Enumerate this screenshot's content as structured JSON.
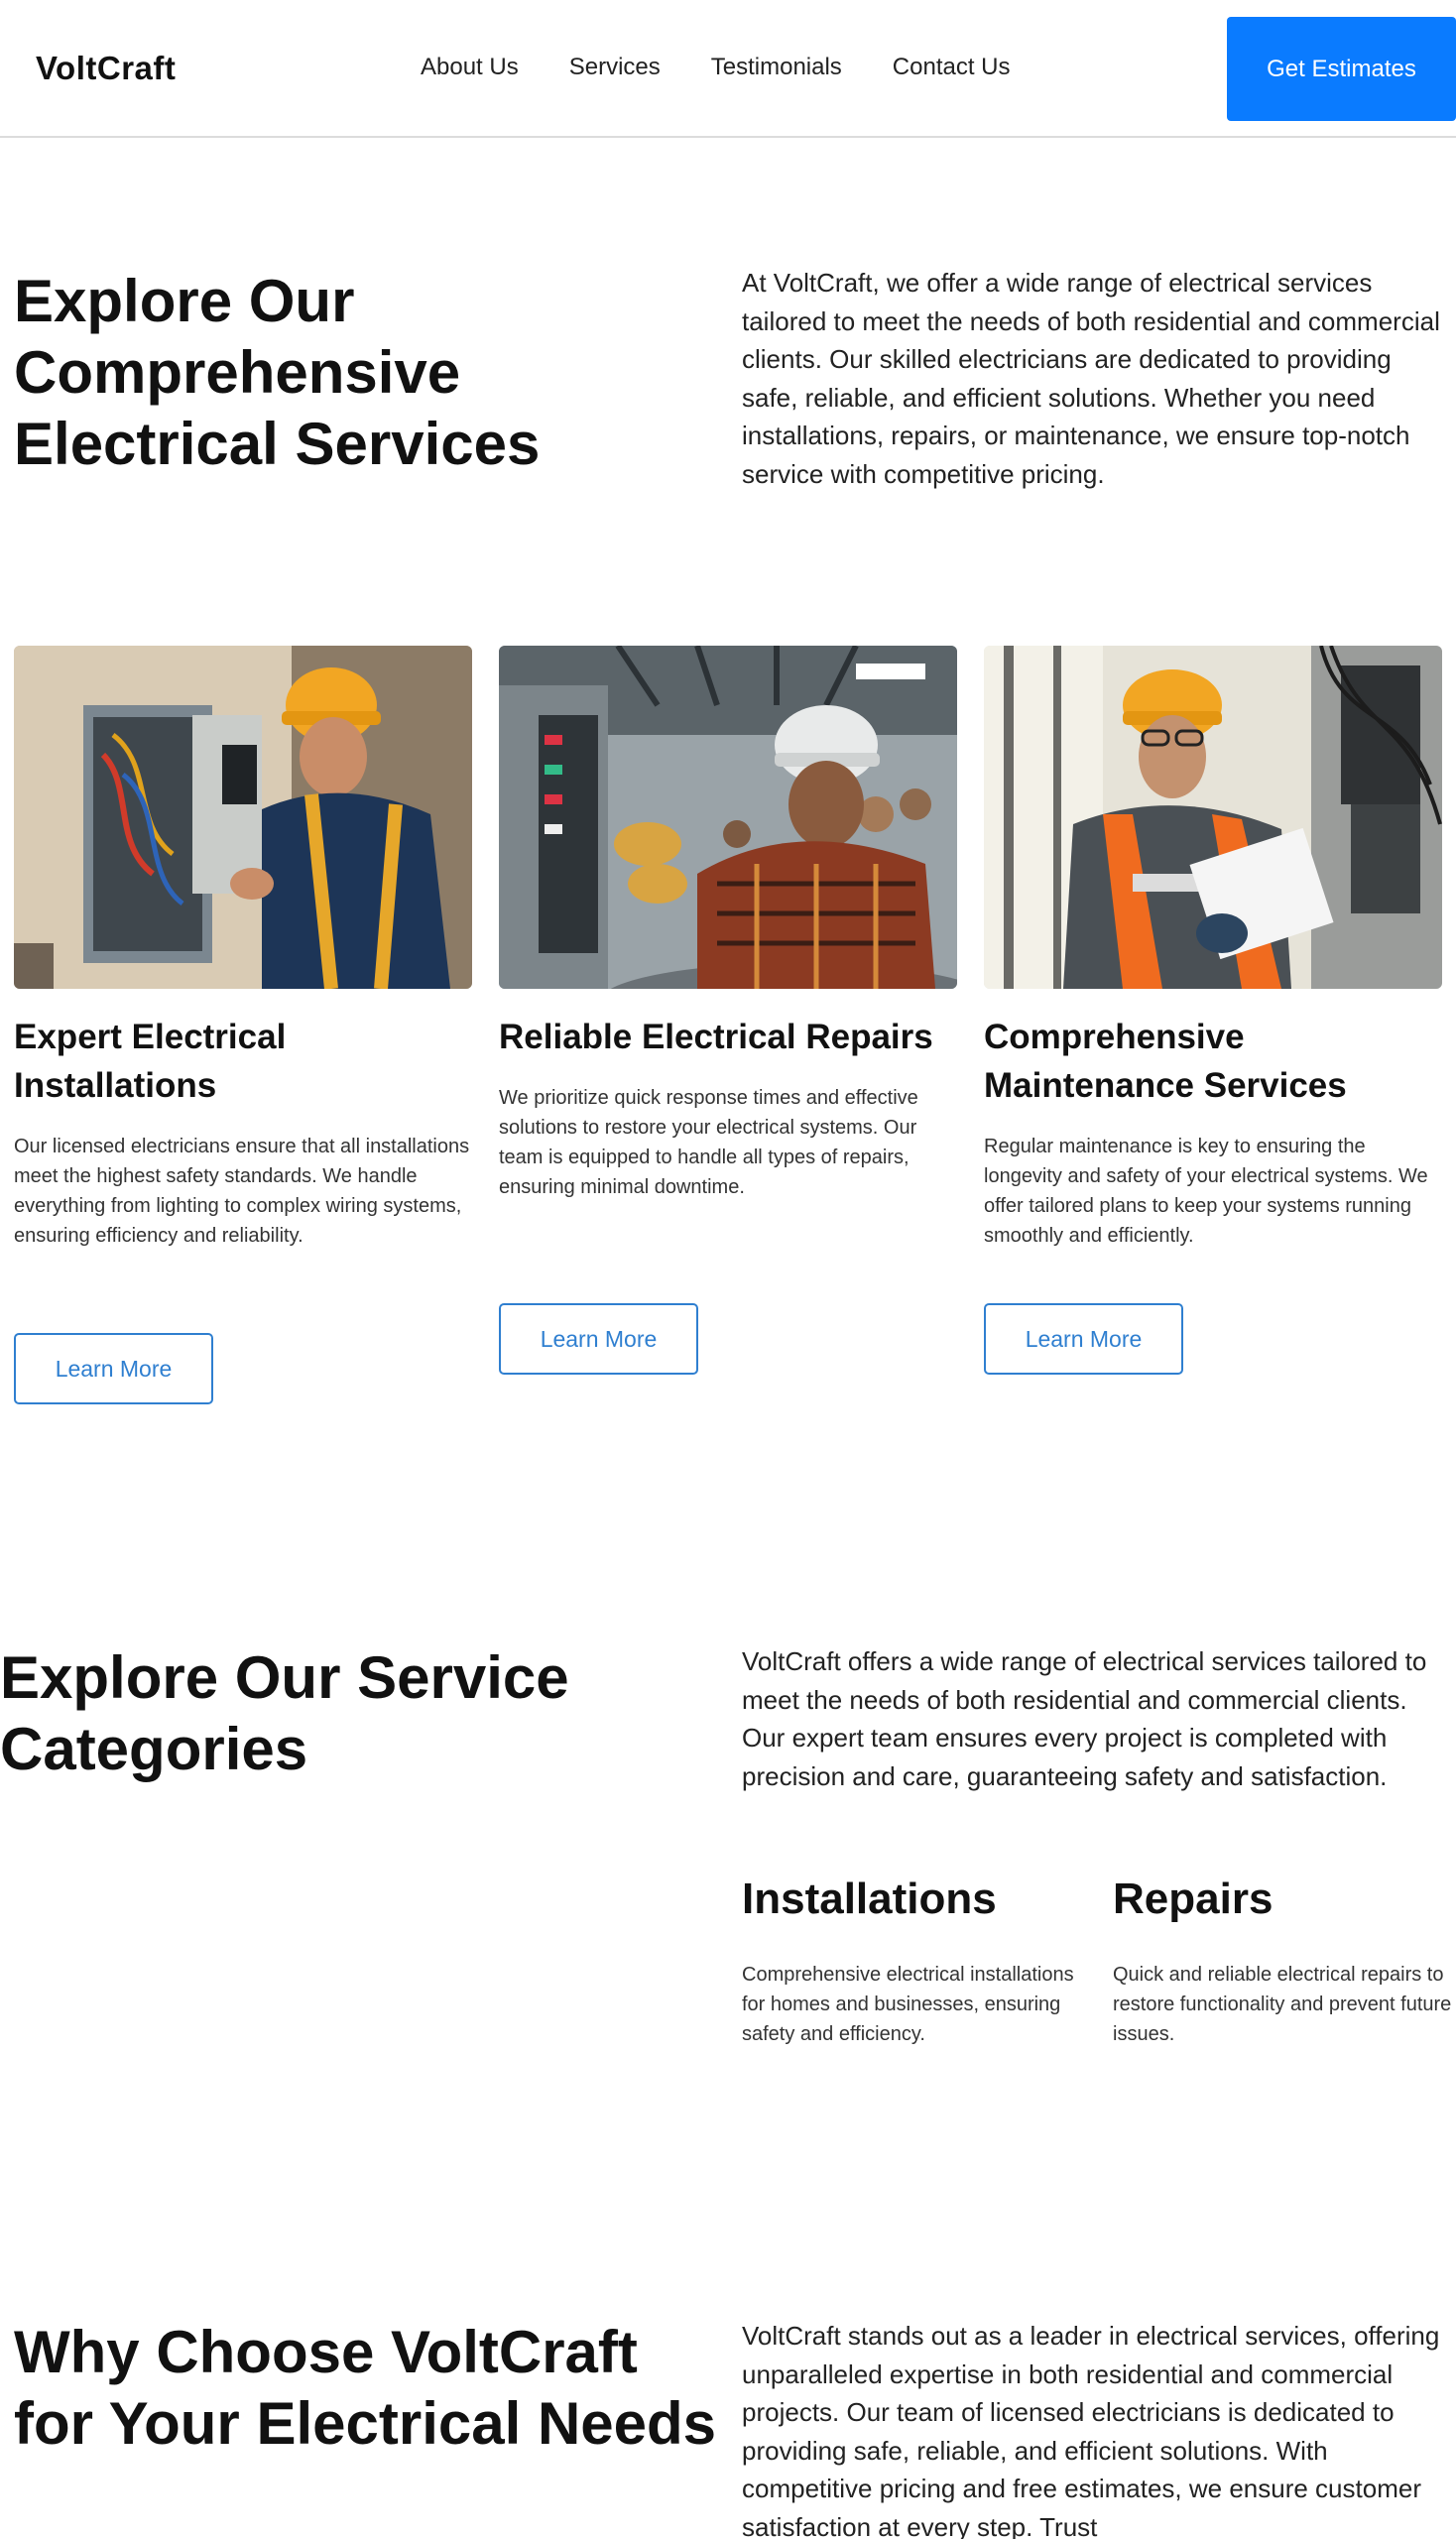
{
  "nav": {
    "logo": "VoltCraft",
    "links": [
      "About Us",
      "Services",
      "Testimonials",
      "Contact Us"
    ],
    "cta": "Get Estimates"
  },
  "hero": {
    "title": "Explore Our Comprehensive Electrical Services",
    "text": "At VoltCraft, we offer a wide range of electrical services tailored to meet the needs of both residential and commercial clients. Our skilled electricians are dedicated to providing safe, reliable, and efficient solutions. Whether you need installations, repairs, or maintenance, we ensure top-notch service with competitive pricing."
  },
  "cards": [
    {
      "title": "Expert Electrical Installations",
      "text": "Our licensed electricians ensure that all installations meet the highest safety standards. We handle everything from lighting to complex wiring systems, ensuring efficiency and reliability.",
      "button": "Learn More"
    },
    {
      "title": "Reliable Electrical Repairs",
      "text": "We prioritize quick response times and effective solutions to restore your electrical systems. Our team is equipped to handle all types of repairs, ensuring minimal downtime.",
      "button": "Learn More"
    },
    {
      "title": "Comprehensive Maintenance Services",
      "text": "Regular maintenance is key to ensuring the longevity and safety of your electrical systems. We offer tailored plans to keep your systems running smoothly and efficiently.",
      "button": "Learn More"
    }
  ],
  "categories": {
    "title": "Explore Our Service Categories",
    "text": "VoltCraft offers a wide range of electrical services tailored to meet the needs of both residential and commercial clients. Our expert team ensures every project is completed with precision and care, guaranteeing safety and satisfaction.",
    "items": [
      {
        "title": "Installations",
        "text": "Comprehensive electrical installations for homes and businesses, ensuring safety and efficiency."
      },
      {
        "title": "Repairs",
        "text": "Quick and reliable electrical repairs to restore functionality and prevent future issues."
      }
    ]
  },
  "why": {
    "title": "Why Choose VoltCraft for Your Electrical Needs",
    "text": "VoltCraft stands out as a leader in electrical services, offering unparalleled expertise in both residential and commercial projects. Our team of licensed electricians is dedicated to providing safe, reliable, and efficient solutions. With competitive pricing and free estimates, we ensure customer satisfaction at every step. Trust"
  },
  "colors": {
    "accent": "#0a7bff",
    "outline_button": "#2f7fd0",
    "text": "#111111"
  },
  "icons": [
    "photo-electrician-installing-panel",
    "photo-electrician-repairing-panel",
    "photo-electrician-maintenance-clipboard"
  ]
}
